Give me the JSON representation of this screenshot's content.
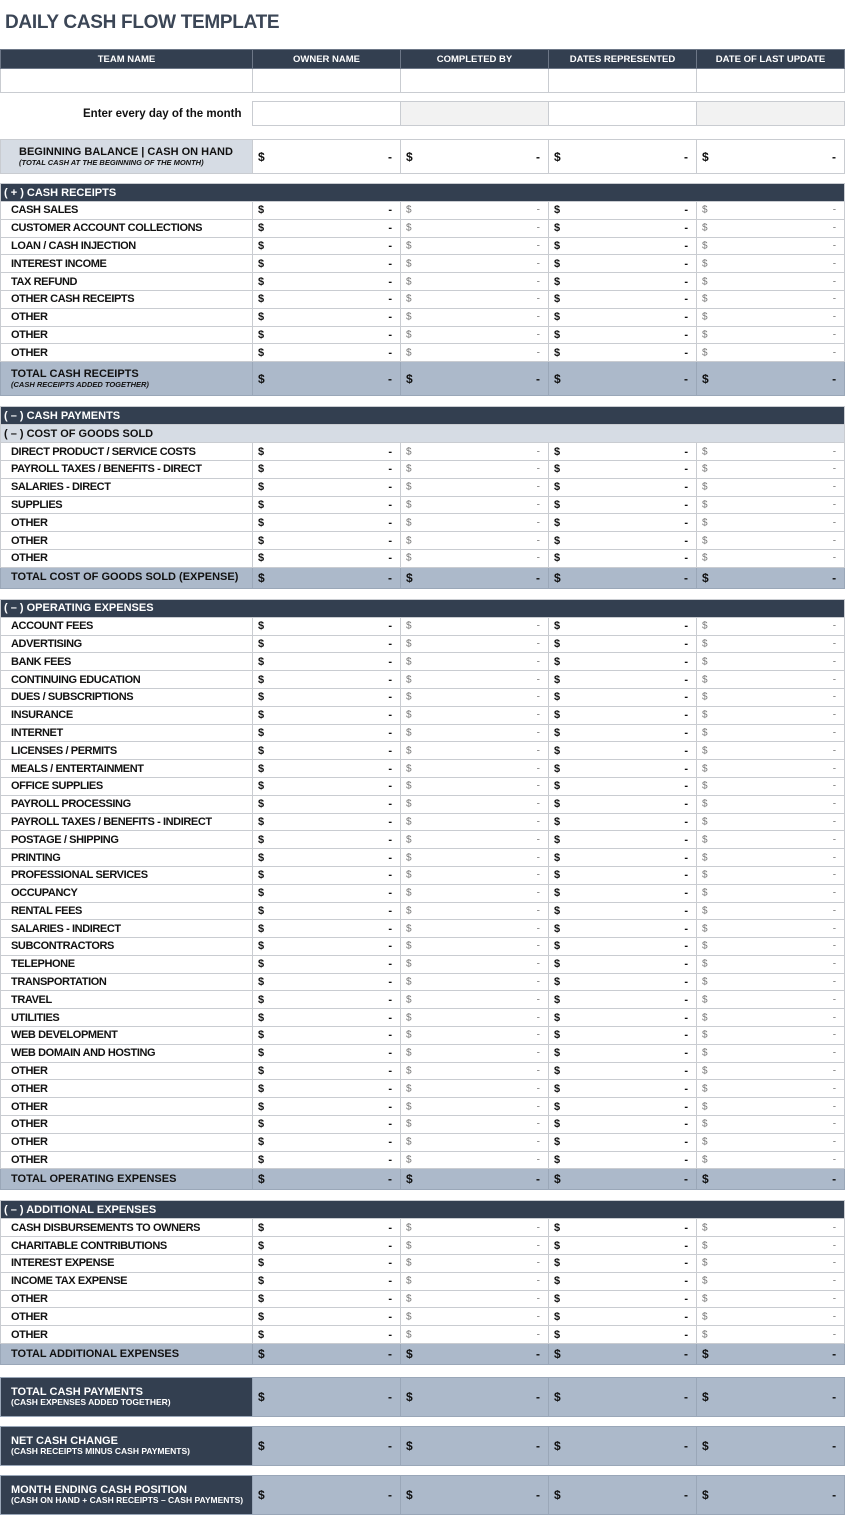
{
  "title": "DAILY CASH FLOW TEMPLATE",
  "header": [
    "TEAM NAME",
    "OWNER NAME",
    "COMPLETED BY",
    "DATES REPRESENTED",
    "DATE OF LAST UPDATE"
  ],
  "entry_label": "Enter every day of the month",
  "currency": "$",
  "dash": "-",
  "beginning": {
    "label": "BEGINNING BALANCE  |  CASH ON HAND",
    "sub": "(TOTAL CASH AT THE BEGINNING OF THE MONTH)"
  },
  "receipts": {
    "header": "( + )  CASH RECEIPTS",
    "items": [
      "CASH SALES",
      "CUSTOMER ACCOUNT COLLECTIONS",
      "LOAN / CASH INJECTION",
      "INTEREST INCOME",
      "TAX REFUND",
      "OTHER CASH RECEIPTS",
      "OTHER",
      "OTHER",
      "OTHER"
    ],
    "total": "TOTAL CASH RECEIPTS",
    "total_sub": "(CASH RECEIPTS ADDED TOGETHER)"
  },
  "payments_header": "( – )  CASH PAYMENTS",
  "cogs": {
    "header": "( – )  COST OF GOODS SOLD",
    "items": [
      "DIRECT PRODUCT / SERVICE COSTS",
      "PAYROLL TAXES / BENEFITS - DIRECT",
      "SALARIES - DIRECT",
      "SUPPLIES",
      "OTHER",
      "OTHER",
      "OTHER"
    ],
    "total": "TOTAL COST OF GOODS SOLD (EXPENSE)"
  },
  "opex": {
    "header": "( – )  OPERATING EXPENSES",
    "items": [
      "ACCOUNT FEES",
      "ADVERTISING",
      "BANK FEES",
      "CONTINUING EDUCATION",
      "DUES / SUBSCRIPTIONS",
      "INSURANCE",
      "INTERNET",
      "LICENSES / PERMITS",
      "MEALS / ENTERTAINMENT",
      "OFFICE SUPPLIES",
      "PAYROLL PROCESSING",
      "PAYROLL TAXES / BENEFITS - INDIRECT",
      "POSTAGE / SHIPPING",
      "PRINTING",
      "PROFESSIONAL SERVICES",
      "OCCUPANCY",
      "RENTAL FEES",
      "SALARIES - INDIRECT",
      "SUBCONTRACTORS",
      "TELEPHONE",
      "TRANSPORTATION",
      "TRAVEL",
      "UTILITIES",
      "WEB DEVELOPMENT",
      "WEB DOMAIN AND HOSTING",
      "OTHER",
      "OTHER",
      "OTHER",
      "OTHER",
      "OTHER",
      "OTHER"
    ],
    "total": "TOTAL OPERATING EXPENSES"
  },
  "additional": {
    "header": "( – )  ADDITIONAL EXPENSES",
    "items": [
      "CASH DISBURSEMENTS TO OWNERS",
      "CHARITABLE CONTRIBUTIONS",
      "INTEREST EXPENSE",
      "INCOME TAX EXPENSE",
      "OTHER",
      "OTHER",
      "OTHER"
    ],
    "total": "TOTAL ADDITIONAL EXPENSES"
  },
  "summary": [
    {
      "label": "TOTAL CASH PAYMENTS",
      "sub": "(CASH EXPENSES ADDED TOGETHER)"
    },
    {
      "label": "NET CASH CHANGE",
      "sub": "(CASH RECEIPTS MINUS CASH PAYMENTS)"
    },
    {
      "label": "MONTH ENDING CASH POSITION",
      "sub": "(CASH ON HAND + CASH RECEIPTS – CASH PAYMENTS)"
    }
  ]
}
